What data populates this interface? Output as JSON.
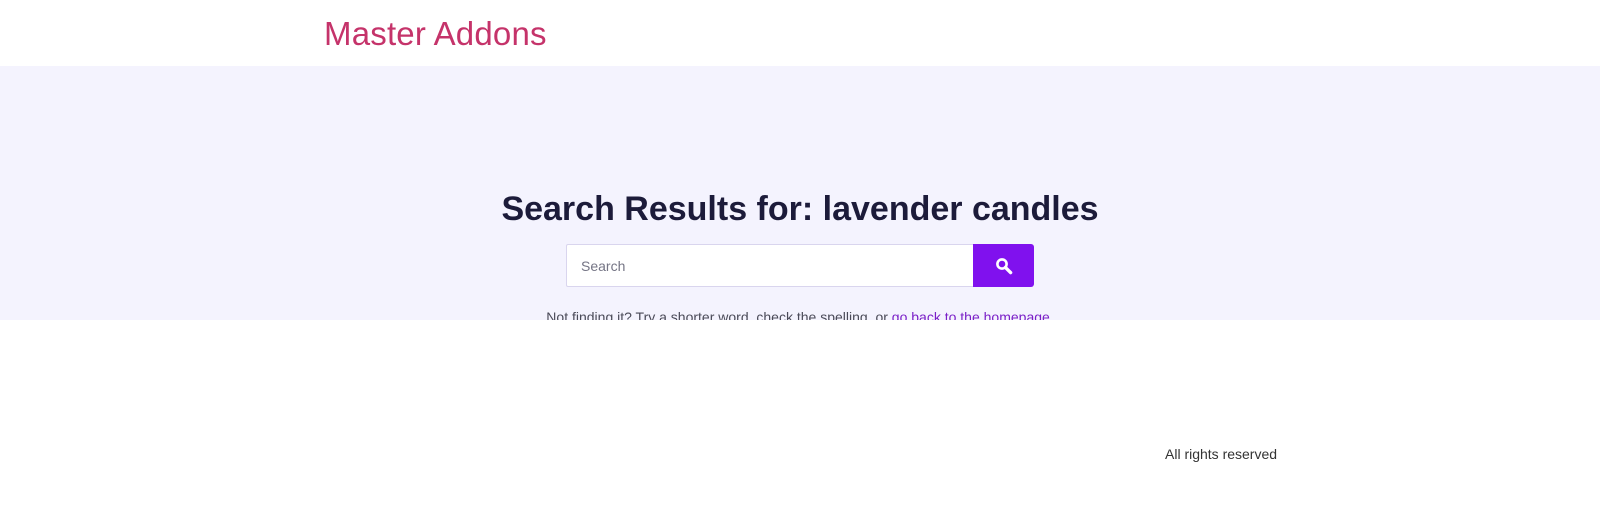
{
  "header": {
    "site_title": "Master Addons"
  },
  "hero": {
    "title": "Search Results for: lavender candles"
  },
  "search": {
    "placeholder": "Search",
    "value": "",
    "button_icon": "search-icon",
    "button_color": "#8011ee"
  },
  "help": {
    "prefix": "Not finding it? Try a shorter word, check the spelling, or ",
    "link_text": "go back to the homepage",
    "suffix": "."
  },
  "footer": {
    "copyright": "All rights reserved"
  },
  "colors": {
    "brand": "#c5336a",
    "accent": "#8011ee",
    "hero_background": "#f4f3fe",
    "link": "#7a1fc7"
  }
}
